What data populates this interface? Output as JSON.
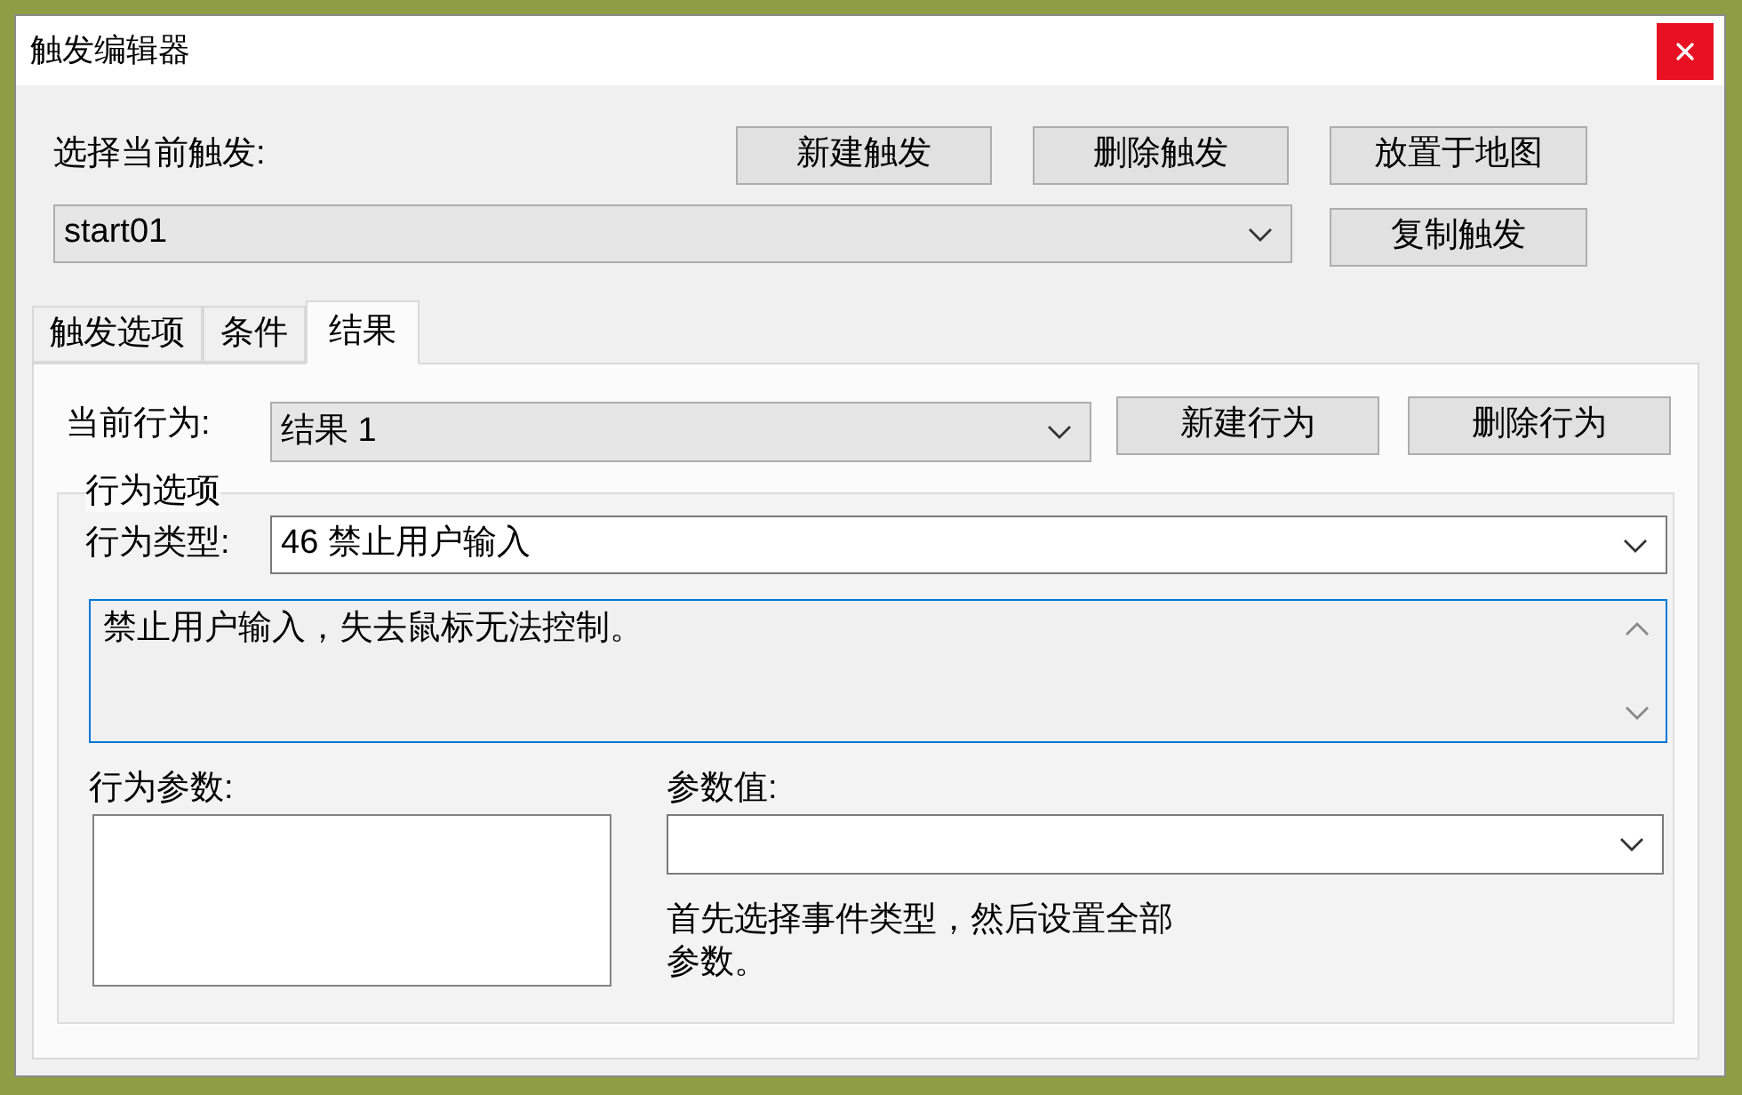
{
  "window": {
    "title": "触发编辑器"
  },
  "trigger": {
    "label": "选择当前触发:",
    "value": "start01"
  },
  "trigger_buttons": [
    "新建触发",
    "删除触发",
    "放置于地图",
    "复制触发"
  ],
  "tabs": [
    {
      "label": "触发选项",
      "selected": false
    },
    {
      "label": "条件",
      "selected": false
    },
    {
      "label": "结果",
      "selected": true
    }
  ],
  "result_panel": {
    "current_action": {
      "label": "当前行为:",
      "value": "结果 1"
    },
    "buttons": [
      "新建行为",
      "删除行为"
    ],
    "action_options": {
      "title": "行为选项",
      "type_label": "行为类型:",
      "type_value": "46 禁止用户输入",
      "description": {
        "text": "禁止用户输入，失去鼠标无法控制。",
        "focused": true
      },
      "params_label": "行为参数:",
      "value_label": "参数值:",
      "hint": "首先选择事件类型，然后设置全部参数。"
    }
  }
}
